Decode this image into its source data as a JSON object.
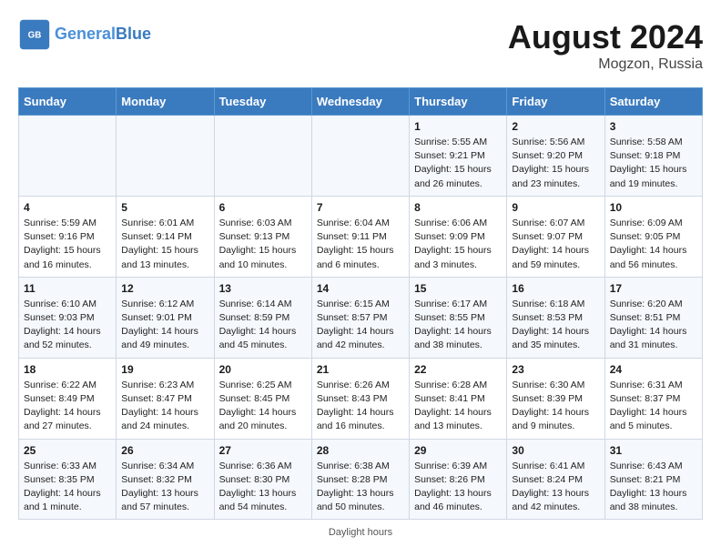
{
  "header": {
    "logo_general": "General",
    "logo_blue": "Blue",
    "month": "August 2024",
    "location": "Mogzon, Russia"
  },
  "days_of_week": [
    "Sunday",
    "Monday",
    "Tuesday",
    "Wednesday",
    "Thursday",
    "Friday",
    "Saturday"
  ],
  "weeks": [
    [
      {
        "day": "",
        "info": ""
      },
      {
        "day": "",
        "info": ""
      },
      {
        "day": "",
        "info": ""
      },
      {
        "day": "",
        "info": ""
      },
      {
        "day": "1",
        "info": "Sunrise: 5:55 AM\nSunset: 9:21 PM\nDaylight: 15 hours\nand 26 minutes."
      },
      {
        "day": "2",
        "info": "Sunrise: 5:56 AM\nSunset: 9:20 PM\nDaylight: 15 hours\nand 23 minutes."
      },
      {
        "day": "3",
        "info": "Sunrise: 5:58 AM\nSunset: 9:18 PM\nDaylight: 15 hours\nand 19 minutes."
      }
    ],
    [
      {
        "day": "4",
        "info": "Sunrise: 5:59 AM\nSunset: 9:16 PM\nDaylight: 15 hours\nand 16 minutes."
      },
      {
        "day": "5",
        "info": "Sunrise: 6:01 AM\nSunset: 9:14 PM\nDaylight: 15 hours\nand 13 minutes."
      },
      {
        "day": "6",
        "info": "Sunrise: 6:03 AM\nSunset: 9:13 PM\nDaylight: 15 hours\nand 10 minutes."
      },
      {
        "day": "7",
        "info": "Sunrise: 6:04 AM\nSunset: 9:11 PM\nDaylight: 15 hours\nand 6 minutes."
      },
      {
        "day": "8",
        "info": "Sunrise: 6:06 AM\nSunset: 9:09 PM\nDaylight: 15 hours\nand 3 minutes."
      },
      {
        "day": "9",
        "info": "Sunrise: 6:07 AM\nSunset: 9:07 PM\nDaylight: 14 hours\nand 59 minutes."
      },
      {
        "day": "10",
        "info": "Sunrise: 6:09 AM\nSunset: 9:05 PM\nDaylight: 14 hours\nand 56 minutes."
      }
    ],
    [
      {
        "day": "11",
        "info": "Sunrise: 6:10 AM\nSunset: 9:03 PM\nDaylight: 14 hours\nand 52 minutes."
      },
      {
        "day": "12",
        "info": "Sunrise: 6:12 AM\nSunset: 9:01 PM\nDaylight: 14 hours\nand 49 minutes."
      },
      {
        "day": "13",
        "info": "Sunrise: 6:14 AM\nSunset: 8:59 PM\nDaylight: 14 hours\nand 45 minutes."
      },
      {
        "day": "14",
        "info": "Sunrise: 6:15 AM\nSunset: 8:57 PM\nDaylight: 14 hours\nand 42 minutes."
      },
      {
        "day": "15",
        "info": "Sunrise: 6:17 AM\nSunset: 8:55 PM\nDaylight: 14 hours\nand 38 minutes."
      },
      {
        "day": "16",
        "info": "Sunrise: 6:18 AM\nSunset: 8:53 PM\nDaylight: 14 hours\nand 35 minutes."
      },
      {
        "day": "17",
        "info": "Sunrise: 6:20 AM\nSunset: 8:51 PM\nDaylight: 14 hours\nand 31 minutes."
      }
    ],
    [
      {
        "day": "18",
        "info": "Sunrise: 6:22 AM\nSunset: 8:49 PM\nDaylight: 14 hours\nand 27 minutes."
      },
      {
        "day": "19",
        "info": "Sunrise: 6:23 AM\nSunset: 8:47 PM\nDaylight: 14 hours\nand 24 minutes."
      },
      {
        "day": "20",
        "info": "Sunrise: 6:25 AM\nSunset: 8:45 PM\nDaylight: 14 hours\nand 20 minutes."
      },
      {
        "day": "21",
        "info": "Sunrise: 6:26 AM\nSunset: 8:43 PM\nDaylight: 14 hours\nand 16 minutes."
      },
      {
        "day": "22",
        "info": "Sunrise: 6:28 AM\nSunset: 8:41 PM\nDaylight: 14 hours\nand 13 minutes."
      },
      {
        "day": "23",
        "info": "Sunrise: 6:30 AM\nSunset: 8:39 PM\nDaylight: 14 hours\nand 9 minutes."
      },
      {
        "day": "24",
        "info": "Sunrise: 6:31 AM\nSunset: 8:37 PM\nDaylight: 14 hours\nand 5 minutes."
      }
    ],
    [
      {
        "day": "25",
        "info": "Sunrise: 6:33 AM\nSunset: 8:35 PM\nDaylight: 14 hours\nand 1 minute."
      },
      {
        "day": "26",
        "info": "Sunrise: 6:34 AM\nSunset: 8:32 PM\nDaylight: 13 hours\nand 57 minutes."
      },
      {
        "day": "27",
        "info": "Sunrise: 6:36 AM\nSunset: 8:30 PM\nDaylight: 13 hours\nand 54 minutes."
      },
      {
        "day": "28",
        "info": "Sunrise: 6:38 AM\nSunset: 8:28 PM\nDaylight: 13 hours\nand 50 minutes."
      },
      {
        "day": "29",
        "info": "Sunrise: 6:39 AM\nSunset: 8:26 PM\nDaylight: 13 hours\nand 46 minutes."
      },
      {
        "day": "30",
        "info": "Sunrise: 6:41 AM\nSunset: 8:24 PM\nDaylight: 13 hours\nand 42 minutes."
      },
      {
        "day": "31",
        "info": "Sunrise: 6:43 AM\nSunset: 8:21 PM\nDaylight: 13 hours\nand 38 minutes."
      }
    ]
  ],
  "footer": {
    "note": "Daylight hours"
  }
}
